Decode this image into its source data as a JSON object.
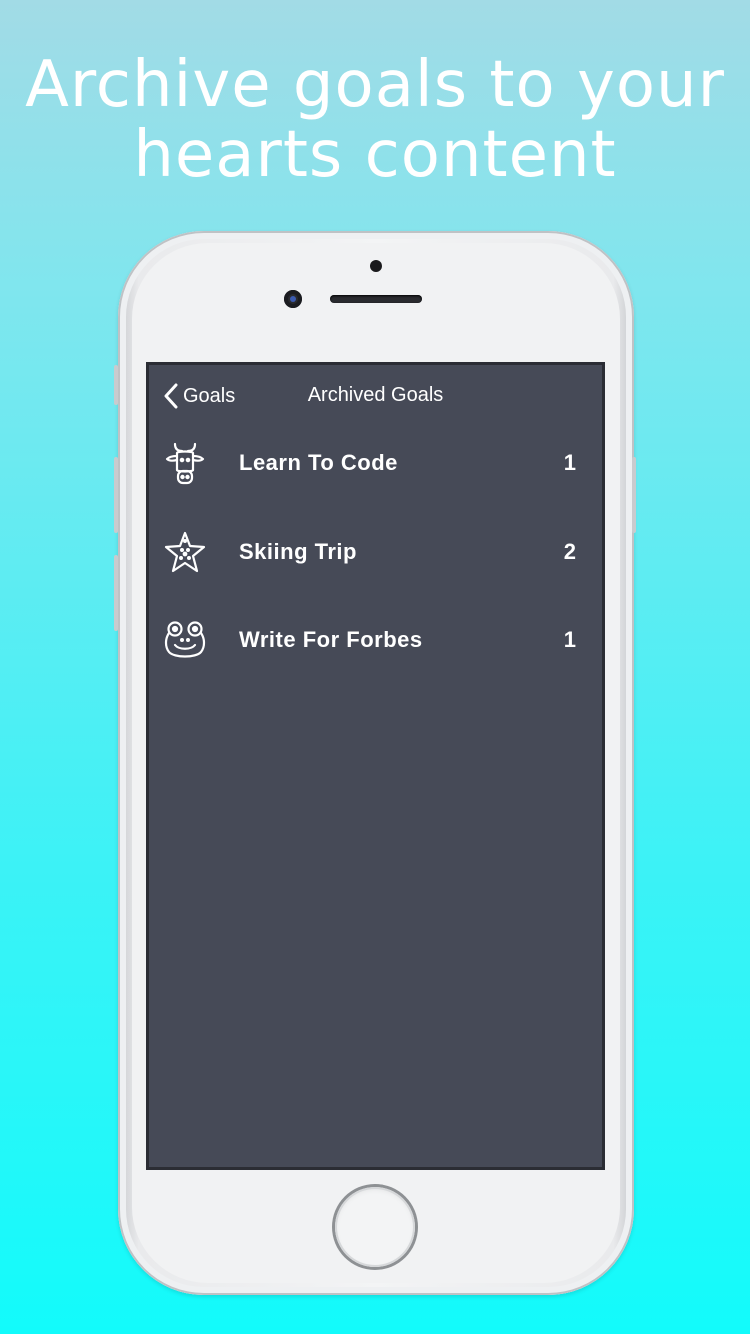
{
  "headline": {
    "line1": "Archive goals to your",
    "line2": "hearts content"
  },
  "nav": {
    "back_label": "Goals",
    "title": "Archived Goals"
  },
  "goals": [
    {
      "name": "Learn To Code",
      "count": "1",
      "icon": "cow-icon"
    },
    {
      "name": "Skiing Trip",
      "count": "2",
      "icon": "starfish-icon"
    },
    {
      "name": "Write For Forbes",
      "count": "1",
      "icon": "frog-icon"
    }
  ],
  "colors": {
    "screen_bg": "#464a57",
    "text": "#ffffff",
    "background_top": "#a2dbe6",
    "background_bottom": "#12fbfb"
  }
}
